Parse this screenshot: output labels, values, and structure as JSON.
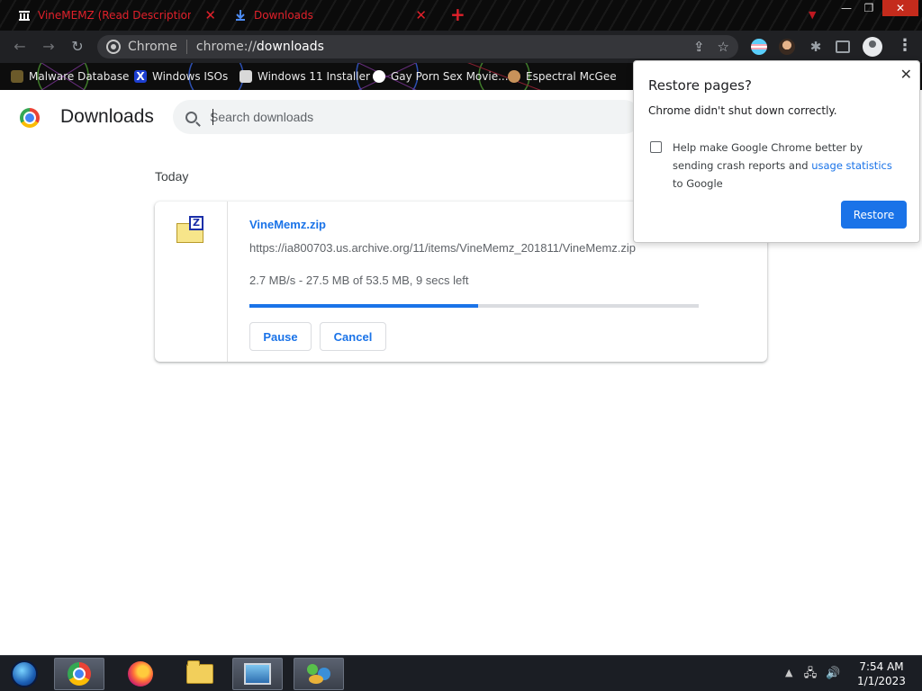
{
  "tabs": [
    {
      "title": "VineMEMZ (Read Description) - I",
      "icon": "archive-icon",
      "close": "✕"
    },
    {
      "title": "Downloads",
      "icon": "download-icon",
      "close": "✕"
    }
  ],
  "new_tab": "+",
  "window_controls": {
    "minimize": "—",
    "maximize": "❐",
    "close": "✕"
  },
  "omnibox": {
    "chip": "Chrome",
    "url_prefix": "chrome://",
    "url_host": "downloads"
  },
  "bookmarks": [
    {
      "label": "Malware Database",
      "icon": "bug-icon"
    },
    {
      "label": "Windows ISOs",
      "icon": "x-logo-icon"
    },
    {
      "label": "Windows 11 Installer",
      "icon": "installer-icon"
    },
    {
      "label": "Gay Porn Sex Movie...",
      "icon": "ghost-icon"
    },
    {
      "label": "Espectral McGee",
      "icon": "avatar-icon"
    }
  ],
  "page": {
    "title": "Downloads",
    "search_placeholder": "Search downloads",
    "section": "Today"
  },
  "download": {
    "file_name": "VineMemz.zip",
    "url": "https://ia800703.us.archive.org/11/items/VineMemz_201811/VineMemz.zip",
    "status": "2.7 MB/s - 27.5 MB of 53.5 MB, 9 secs left",
    "progress_fraction": 0.51,
    "pause_label": "Pause",
    "cancel_label": "Cancel",
    "zip_badge": "Z"
  },
  "restore_popup": {
    "title": "Restore pages?",
    "message": "Chrome didn't shut down correctly.",
    "crash_text_before": "Help make Google Chrome better by sending crash reports and ",
    "crash_link": "usage statistics",
    "crash_text_after": " to Google",
    "button": "Restore",
    "close": "✕"
  },
  "taskbar": {
    "time": "7:54 AM",
    "date": "1/1/2023"
  },
  "colors": {
    "accent": "#1a73e8",
    "tab_text": "#e0202a",
    "toolbar": "#202124"
  }
}
